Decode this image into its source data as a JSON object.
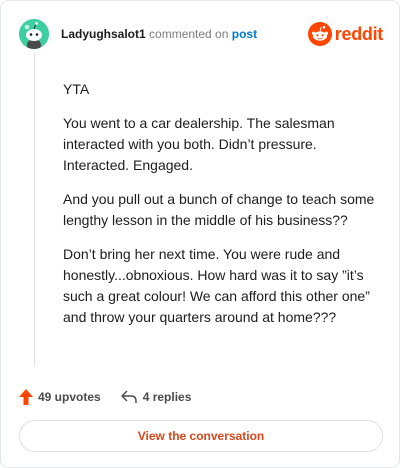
{
  "header": {
    "username": "Ladyughsalot1",
    "commented_on": "commented on",
    "post_link": "post",
    "brand": "reddit"
  },
  "comment": {
    "paragraphs": [
      "YTA",
      "You went to a car dealership. The salesman interacted with you both. Didn’t pressure. Interacted. Engaged.",
      "And you pull out a bunch of change to teach some lengthy lesson in the middle of his business??",
      "Don’t bring her next time. You were rude and honestly...obnoxious. How hard was it to say ”it’s such a great colour! We can afford this other one” and throw your quarters around at home???"
    ]
  },
  "stats": {
    "upvotes": "49 upvotes",
    "replies": "4 replies"
  },
  "cta": {
    "label": "View the conversation"
  },
  "colors": {
    "brand": "#ff4500",
    "avatar_bg": "#3ecfa0",
    "link": "#0079d3",
    "cta_text": "#d9471a"
  },
  "icons": {
    "avatar": "snoo-avatar-icon",
    "logo": "reddit-logo-icon",
    "upvote": "upvote-arrow-icon",
    "reply": "reply-arrow-icon"
  }
}
